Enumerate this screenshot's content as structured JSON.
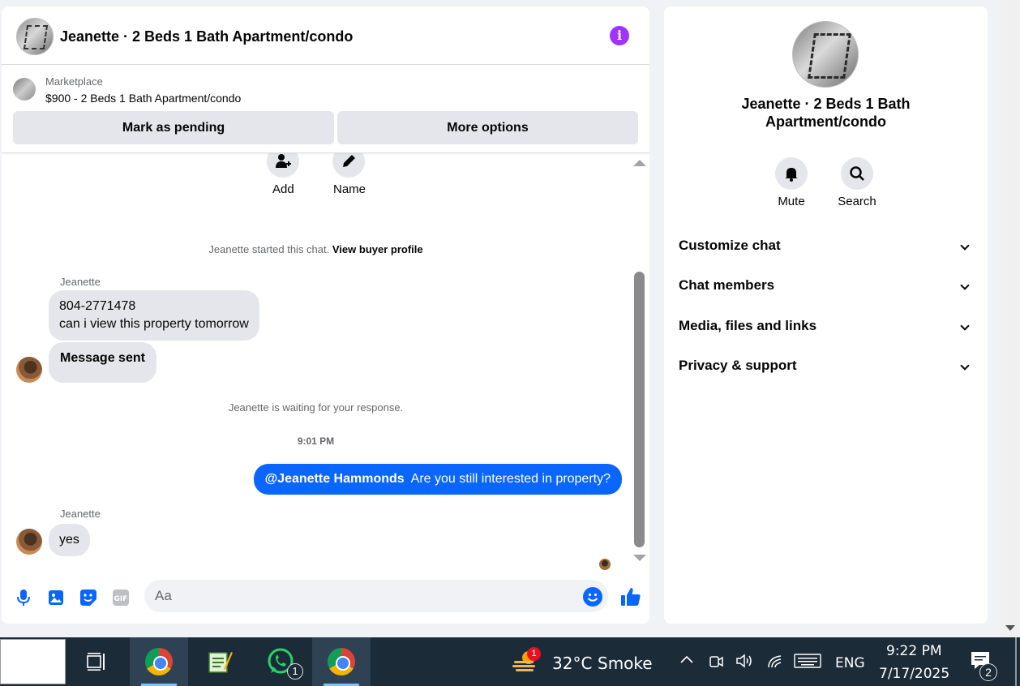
{
  "chat_header": {
    "title": "Jeanette · 2 Beds 1 Bath Apartment/condo"
  },
  "listing": {
    "source": "Marketplace",
    "price_title": "$900 - 2 Beds 1 Bath Apartment/condo",
    "pending_button": "Mark as pending",
    "more_button": "More options"
  },
  "chat_actions": {
    "add": "Add",
    "name": "Name"
  },
  "messages": {
    "started_text": "Jeanette started this chat.",
    "buyer_profile_link": "View buyer profile",
    "sender_1": "Jeanette",
    "msg_1_line1": "804-2771478",
    "msg_1_line2": "can i view this property tomorrow",
    "msg_2": "Message sent",
    "waiting_text": "Jeanette is waiting for your response.",
    "timestamp": "9:01 PM",
    "out_mention": "@Jeanette Hammonds",
    "out_text": "Are you still interested in property?",
    "sender_2": "Jeanette",
    "msg_3": "yes"
  },
  "composer": {
    "placeholder": "Aa"
  },
  "info_panel": {
    "title": "Jeanette · 2 Beds 1 Bath Apartment/condo",
    "mute_label": "Mute",
    "search_label": "Search",
    "sections": [
      "Customize chat",
      "Chat members",
      "Media, files and links",
      "Privacy & support"
    ]
  },
  "taskbar": {
    "weather_badge": "1",
    "temperature": "32°C",
    "weather": "Smoke",
    "whatsapp_badge": "1",
    "language": "ENG",
    "time": "9:22 PM",
    "date": "7/17/2025",
    "notifications_badge": "2"
  },
  "colors": {
    "accent": "#0a66ff",
    "info_icon": "#a033ff",
    "taskbar": "#1c2b38"
  }
}
